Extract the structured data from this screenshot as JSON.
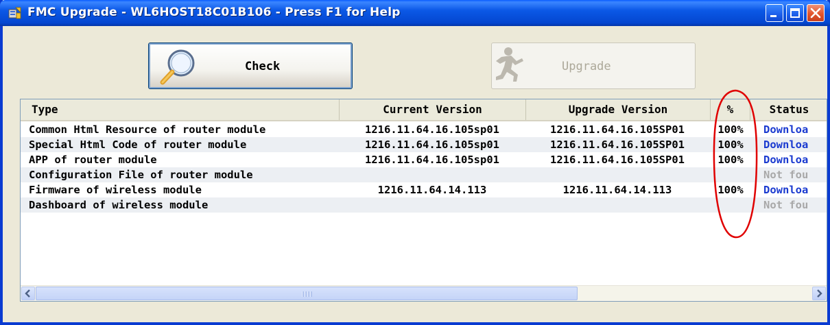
{
  "window": {
    "title": "FMC Upgrade - WL6HOST18C01B106 - Press F1 for Help",
    "controls": [
      "minimize",
      "maximize",
      "close"
    ]
  },
  "toolbar": {
    "check": {
      "label": "Check",
      "icon": "magnifier-icon"
    },
    "upgrade": {
      "label": "Upgrade",
      "icon": "running-man-icon",
      "disabled": true
    }
  },
  "table": {
    "columns": [
      "Type",
      "Current Version",
      "Upgrade Version",
      "%",
      "Status"
    ],
    "rows": [
      {
        "type": "Common Html Resource of router module",
        "current": "1216.11.64.16.105sp01",
        "upgrade": "1216.11.64.16.105SP01",
        "pct": "100%",
        "status": "Downloa"
      },
      {
        "type": "Special Html Code of router module",
        "current": "1216.11.64.16.105sp01",
        "upgrade": "1216.11.64.16.105SP01",
        "pct": "100%",
        "status": "Downloa"
      },
      {
        "type": "APP of router module",
        "current": "1216.11.64.16.105sp01",
        "upgrade": "1216.11.64.16.105SP01",
        "pct": "100%",
        "status": "Downloa"
      },
      {
        "type": "Configuration File of router module",
        "current": "",
        "upgrade": "",
        "pct": "",
        "status": "Not fou"
      },
      {
        "type": "Firmware of wireless module",
        "current": "1216.11.64.14.113",
        "upgrade": "1216.11.64.14.113",
        "pct": "100%",
        "status": "Downloa"
      },
      {
        "type": "Dashboard of wireless module",
        "current": "",
        "upgrade": "",
        "pct": "",
        "status": "Not fou"
      }
    ]
  },
  "colors": {
    "titlebar": "#0B58E6",
    "window_bg": "#ECE9D8",
    "status_download": "#1A3AD0",
    "status_notfound": "#A8A8A8",
    "annotation": "#E00000"
  }
}
